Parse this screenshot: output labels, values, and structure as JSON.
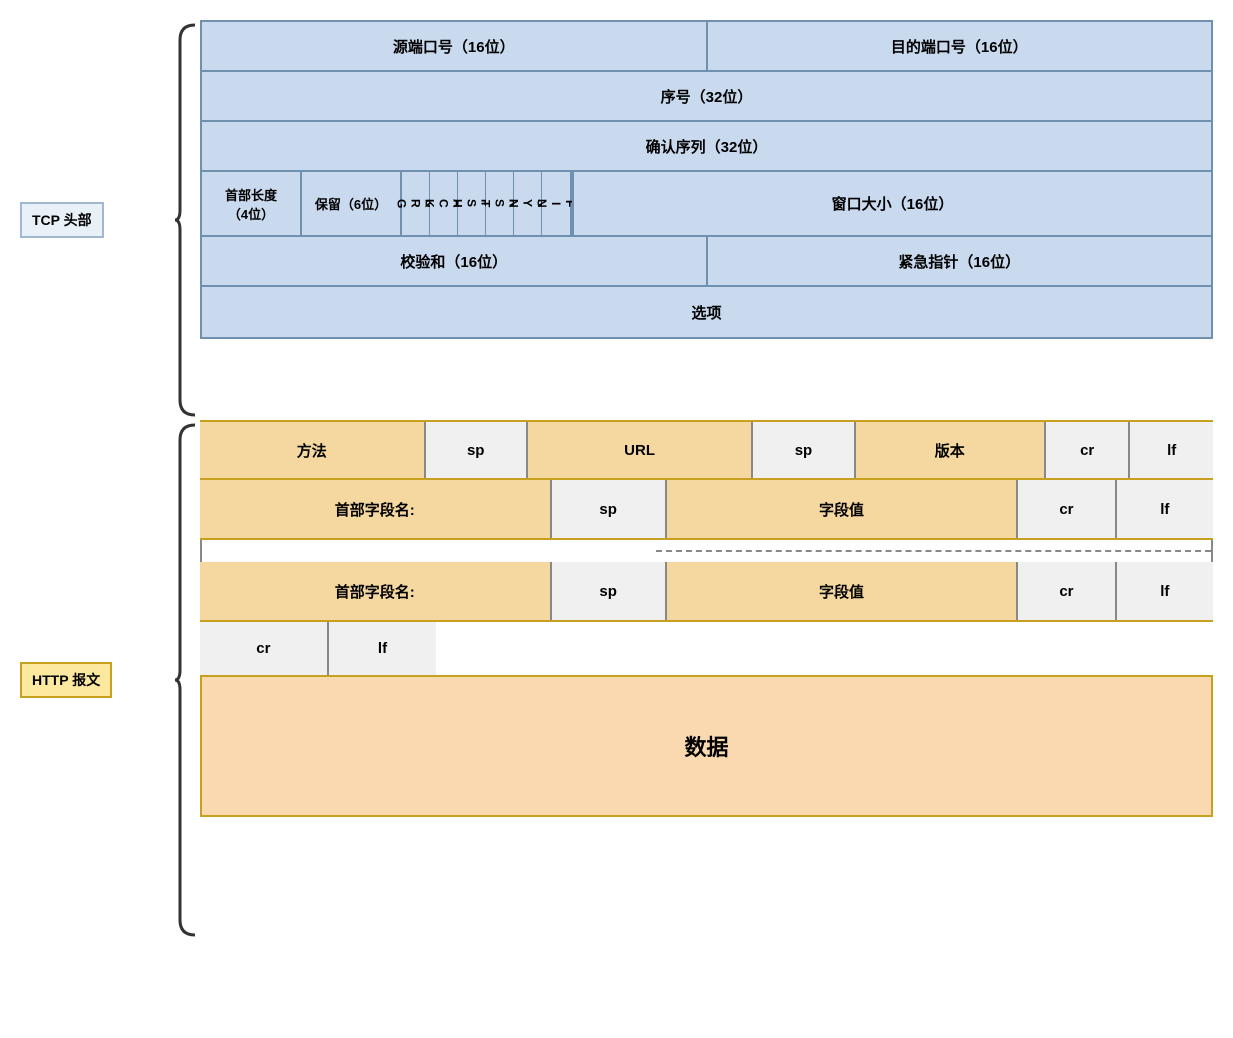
{
  "tcp_label": "TCP 头部",
  "http_label": "HTTP 报文",
  "tcp": {
    "row1": {
      "left": "源端口号（16位）",
      "right": "目的端口号（16位）"
    },
    "row2": "序号（32位）",
    "row3": "确认序列（32位）",
    "row4": {
      "header_len": "首部长度\n（4位）",
      "reserved": "保留（6位）",
      "flags": [
        "U\nR\nG",
        "A\nC\nK",
        "P\nS\nH",
        "R\nS\nT",
        "S\nY\nN",
        "F\nI\nN"
      ],
      "window": "窗口大小（16位）"
    },
    "row5": {
      "left": "校验和（16位）",
      "right": "紧急指针（16位）"
    },
    "row6": "选项"
  },
  "http": {
    "row1": {
      "cells": [
        {
          "text": "方法",
          "type": "orange"
        },
        {
          "text": "sp",
          "type": "white"
        },
        {
          "text": "URL",
          "type": "orange"
        },
        {
          "text": "sp",
          "type": "white"
        },
        {
          "text": "版本",
          "type": "orange"
        },
        {
          "text": "cr",
          "type": "white"
        },
        {
          "text": "lf",
          "type": "white"
        }
      ]
    },
    "row2": {
      "cells": [
        {
          "text": "首部字段名:",
          "type": "orange"
        },
        {
          "text": "sp",
          "type": "white"
        },
        {
          "text": "字段值",
          "type": "orange"
        },
        {
          "text": "cr",
          "type": "white"
        },
        {
          "text": "lf",
          "type": "white"
        }
      ]
    },
    "dotted": true,
    "row3": {
      "cells": [
        {
          "text": "首部字段名:",
          "type": "orange"
        },
        {
          "text": "sp",
          "type": "white"
        },
        {
          "text": "字段值",
          "type": "orange"
        },
        {
          "text": "cr",
          "type": "white"
        },
        {
          "text": "lf",
          "type": "white"
        }
      ]
    },
    "row4": {
      "cells": [
        {
          "text": "cr",
          "type": "white"
        },
        {
          "text": "lf",
          "type": "white"
        }
      ]
    },
    "data_row": "数据"
  }
}
